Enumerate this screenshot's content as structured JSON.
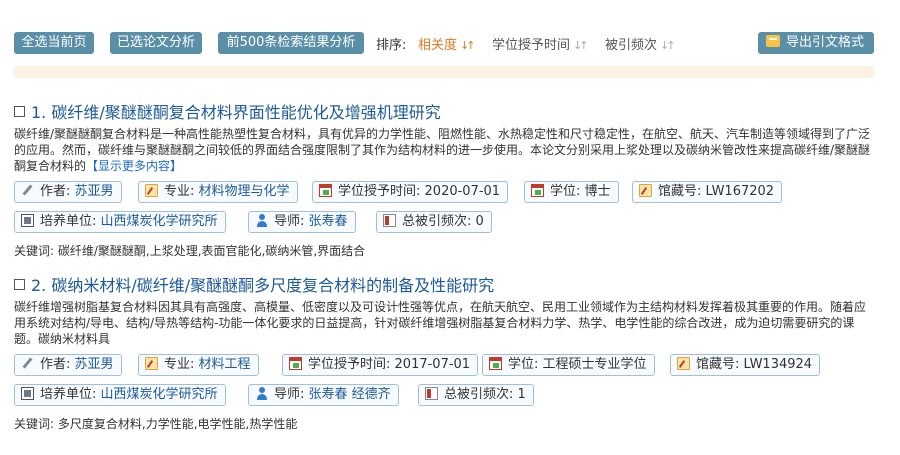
{
  "toolbar": {
    "select_page": "全选当前页",
    "analyze_selected": "已选论文分析",
    "analyze_top500": "前500条检索结果分析",
    "sort_label": "排序:",
    "sort_relevance": "相关度",
    "sort_degree_time": "学位授予时间",
    "sort_citations": "被引频次",
    "export": "导出引文格式"
  },
  "labels": {
    "author": "作者:",
    "major": "专业:",
    "degree_time": "学位授予时间:",
    "degree": "学位:",
    "collection_no": "馆藏号:",
    "institution": "培养单位:",
    "advisor": "导师:",
    "citations": "总被引频次:",
    "keywords": "关键词:",
    "more": "【显示更多内容】"
  },
  "records": [
    {
      "title": "1. 碳纤维/聚醚醚酮复合材料界面性能优化及增强机理研究",
      "abstract": "碳纤维/聚醚醚酮复合材料是一种高性能热塑性复合材料，具有优异的力学性能、阻燃性能、水热稳定性和尺寸稳定性，在航空、航天、汽车制造等领域得到了广泛的应用。然而，碳纤维与聚醚醚酮之间较低的界面结合强度限制了其作为结构材料的进一步使用。本论文分别采用上浆处理以及碳纳米管改性来提高碳纤维/聚醚醚酮复合材料的",
      "author": "苏亚男",
      "major": "材料物理与化学",
      "degree_time": "2020-07-01",
      "degree": "博士",
      "collection_no": "LW167202",
      "institution": "山西煤炭化学研究所",
      "advisor": "张寿春",
      "citations": "0",
      "keywords": "碳纤维/聚醚醚酮,上浆处理,表面官能化,碳纳米管,界面结合"
    },
    {
      "title": "2. 碳纳米材料/碳纤维/聚醚醚酮多尺度复合材料的制备及性能研究",
      "abstract": "碳纤维增强树脂基复合材料因其具有高强度、高模量、低密度以及可设计性强等优点，在航天航空、民用工业领域作为主结构材料发挥着极其重要的作用。随着应用系统对结构/导电、结构/导热等结构-功能一体化要求的日益提高，针对碳纤维增强树脂基复合材料力学、热学、电学性能的综合改进，成为迫切需要研究的课题。碳纳米材料具",
      "author": "苏亚男",
      "major": "材料工程",
      "degree_time": "2017-07-01",
      "degree": "工程硕士专业学位",
      "collection_no": "LW134924",
      "institution": "山西煤炭化学研究所",
      "advisor": "张寿春 经德齐",
      "citations": "1",
      "keywords": "多尺度复合材料,力学性能,电学性能,热学性能"
    }
  ],
  "colors": {
    "button_bg": "#5b8fa8",
    "title_link": "#1d5a99",
    "sort_active": "#e07b1e",
    "tag_border": "#9fc0dd"
  },
  "icons": {
    "author": "pen-icon",
    "major": "edit-icon",
    "degree_time": "calendar-icon",
    "degree": "calendar-icon",
    "collection_no": "edit-icon",
    "institution": "board-icon",
    "advisor": "person-icon",
    "citations": "book-icon",
    "export": "export-icon"
  }
}
